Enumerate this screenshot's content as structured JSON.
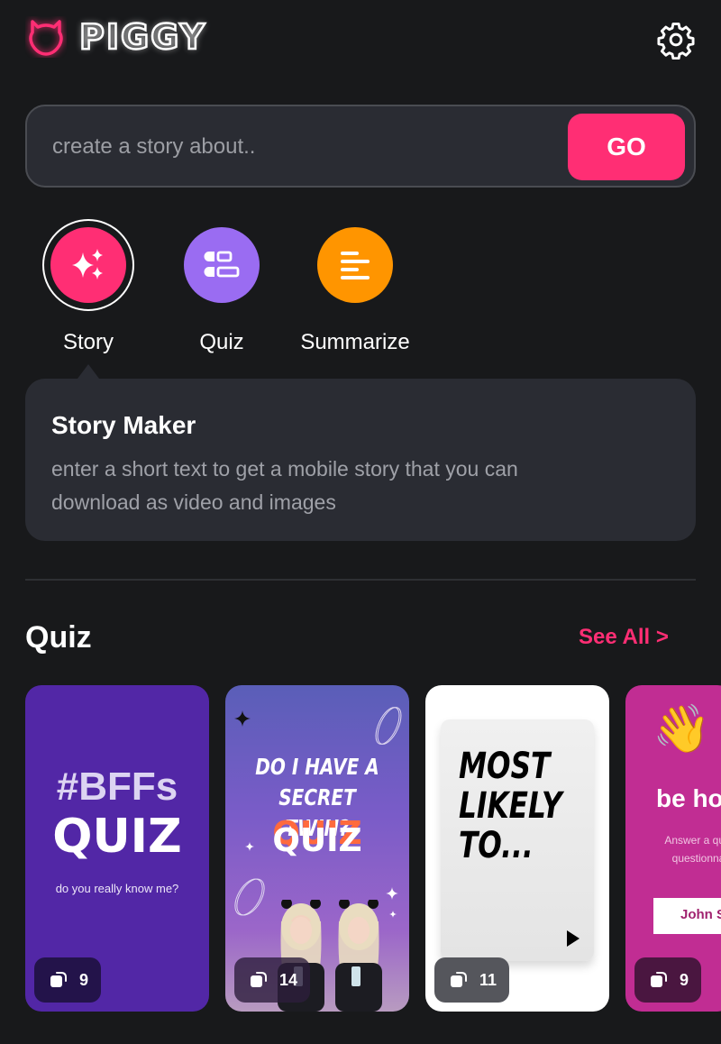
{
  "header": {
    "app_name": "PIGGY",
    "logo_icon": "pig-outline-icon",
    "settings_icon": "gear-icon"
  },
  "search": {
    "placeholder": "create a story about..",
    "value": "",
    "go_label": "GO"
  },
  "modes": [
    {
      "label": "Story",
      "icon": "sparkles-icon",
      "color": "#ff2e74",
      "selected": true
    },
    {
      "label": "Quiz",
      "icon": "quiz-list-icon",
      "color": "#9a6cf2",
      "selected": false
    },
    {
      "label": "Summarize",
      "icon": "align-left-icon",
      "color": "#ff9500",
      "selected": false
    }
  ],
  "info": {
    "title": "Story Maker",
    "description": "enter a short text to get a mobile story that you can download as video and images"
  },
  "quiz_section": {
    "title": "Quiz",
    "see_all": "See All >",
    "cards": [
      {
        "hashtag": "#BFFs",
        "title": "QUIZ",
        "subtitle": "do you really know me?",
        "count": "9"
      },
      {
        "title": "DO I HAVE A SECRET TWIN?",
        "tag": "QUIZ",
        "count": "14"
      },
      {
        "title": "MOST LIKELY TO...",
        "count": "11"
      },
      {
        "title": "be ho",
        "subtitle": "Answer a quic questionna",
        "input_value": "John S",
        "count": "9"
      }
    ]
  },
  "colors": {
    "background": "#18191b",
    "accent": "#ff2e74",
    "surface": "#2a2c33"
  }
}
